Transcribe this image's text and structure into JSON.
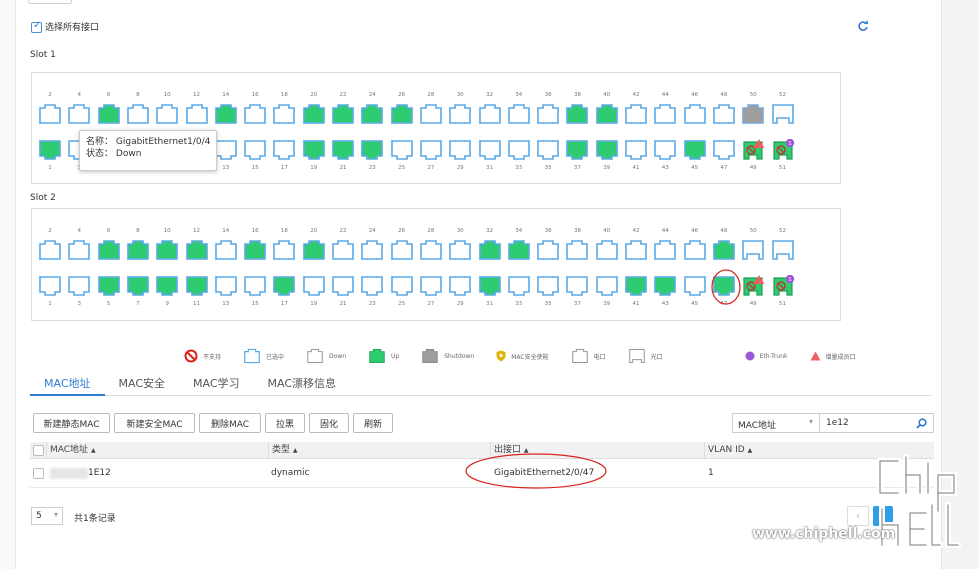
{
  "header": {
    "select_all_label": "选择所有接口"
  },
  "slots": [
    {
      "title": "Slot 1",
      "top_row": [
        {
          "num": "2",
          "state": "sel"
        },
        {
          "num": "4",
          "state": "sel"
        },
        {
          "num": "6",
          "state": "up"
        },
        {
          "num": "8",
          "state": "sel"
        },
        {
          "num": "10",
          "state": "sel"
        },
        {
          "num": "12",
          "state": "sel"
        },
        {
          "num": "14",
          "state": "up"
        },
        {
          "num": "16",
          "state": "sel"
        },
        {
          "num": "18",
          "state": "sel"
        },
        {
          "num": "20",
          "state": "up"
        },
        {
          "num": "22",
          "state": "up"
        },
        {
          "num": "24",
          "state": "up"
        },
        {
          "num": "26",
          "state": "up"
        },
        {
          "num": "28",
          "state": "sel"
        },
        {
          "num": "30",
          "state": "sel"
        },
        {
          "num": "32",
          "state": "sel"
        },
        {
          "num": "34",
          "state": "sel"
        },
        {
          "num": "36",
          "state": "sel"
        },
        {
          "num": "38",
          "state": "up"
        },
        {
          "num": "40",
          "state": "up"
        },
        {
          "num": "42",
          "state": "sel"
        },
        {
          "num": "44",
          "state": "sel"
        },
        {
          "num": "46",
          "state": "sel"
        },
        {
          "num": "48",
          "state": "sel"
        },
        {
          "num": "50",
          "state": "shutdown"
        },
        {
          "num": "52",
          "state": "optical"
        }
      ],
      "bottom_row": [
        {
          "num": "1",
          "state": "up"
        },
        {
          "num": "3",
          "state": "sel"
        },
        {
          "num": "5",
          "state": "sel"
        },
        {
          "num": "7",
          "state": "sel"
        },
        {
          "num": "9",
          "state": "sel"
        },
        {
          "num": "11",
          "state": "sel"
        },
        {
          "num": "13",
          "state": "sel"
        },
        {
          "num": "15",
          "state": "sel"
        },
        {
          "num": "17",
          "state": "sel"
        },
        {
          "num": "19",
          "state": "up"
        },
        {
          "num": "21",
          "state": "up"
        },
        {
          "num": "23",
          "state": "up"
        },
        {
          "num": "25",
          "state": "sel"
        },
        {
          "num": "27",
          "state": "sel"
        },
        {
          "num": "29",
          "state": "sel"
        },
        {
          "num": "31",
          "state": "sel"
        },
        {
          "num": "33",
          "state": "sel"
        },
        {
          "num": "35",
          "state": "sel"
        },
        {
          "num": "37",
          "state": "up"
        },
        {
          "num": "39",
          "state": "up"
        },
        {
          "num": "41",
          "state": "sel"
        },
        {
          "num": "43",
          "state": "sel"
        },
        {
          "num": "45",
          "state": "up"
        },
        {
          "num": "47",
          "state": "sel"
        },
        {
          "num": "49",
          "state": "special_member"
        },
        {
          "num": "51",
          "state": "special_trunk"
        }
      ]
    },
    {
      "title": "Slot 2",
      "top_row": [
        {
          "num": "2",
          "state": "sel"
        },
        {
          "num": "4",
          "state": "sel"
        },
        {
          "num": "6",
          "state": "up"
        },
        {
          "num": "8",
          "state": "up"
        },
        {
          "num": "10",
          "state": "up"
        },
        {
          "num": "12",
          "state": "up"
        },
        {
          "num": "14",
          "state": "sel"
        },
        {
          "num": "16",
          "state": "up"
        },
        {
          "num": "18",
          "state": "sel"
        },
        {
          "num": "20",
          "state": "up"
        },
        {
          "num": "22",
          "state": "sel"
        },
        {
          "num": "24",
          "state": "sel"
        },
        {
          "num": "26",
          "state": "sel"
        },
        {
          "num": "28",
          "state": "sel"
        },
        {
          "num": "30",
          "state": "sel"
        },
        {
          "num": "32",
          "state": "up"
        },
        {
          "num": "34",
          "state": "up"
        },
        {
          "num": "36",
          "state": "sel"
        },
        {
          "num": "38",
          "state": "sel"
        },
        {
          "num": "40",
          "state": "sel"
        },
        {
          "num": "42",
          "state": "sel"
        },
        {
          "num": "44",
          "state": "sel"
        },
        {
          "num": "46",
          "state": "sel"
        },
        {
          "num": "48",
          "state": "up"
        },
        {
          "num": "50",
          "state": "optical"
        },
        {
          "num": "52",
          "state": "optical"
        }
      ],
      "bottom_row": [
        {
          "num": "1",
          "state": "sel"
        },
        {
          "num": "3",
          "state": "sel"
        },
        {
          "num": "5",
          "state": "up"
        },
        {
          "num": "7",
          "state": "up"
        },
        {
          "num": "9",
          "state": "up"
        },
        {
          "num": "11",
          "state": "up"
        },
        {
          "num": "13",
          "state": "sel"
        },
        {
          "num": "15",
          "state": "sel"
        },
        {
          "num": "17",
          "state": "up"
        },
        {
          "num": "19",
          "state": "sel"
        },
        {
          "num": "21",
          "state": "sel"
        },
        {
          "num": "23",
          "state": "sel"
        },
        {
          "num": "25",
          "state": "sel"
        },
        {
          "num": "27",
          "state": "sel"
        },
        {
          "num": "29",
          "state": "sel"
        },
        {
          "num": "31",
          "state": "up"
        },
        {
          "num": "33",
          "state": "sel"
        },
        {
          "num": "35",
          "state": "sel"
        },
        {
          "num": "37",
          "state": "sel"
        },
        {
          "num": "39",
          "state": "sel"
        },
        {
          "num": "41",
          "state": "up"
        },
        {
          "num": "43",
          "state": "up"
        },
        {
          "num": "45",
          "state": "sel"
        },
        {
          "num": "47",
          "state": "up"
        },
        {
          "num": "49",
          "state": "special_member"
        },
        {
          "num": "51",
          "state": "special_trunk"
        }
      ]
    }
  ],
  "tooltip": {
    "name_label": "名称：",
    "name_value": "GigabitEthernet1/0/4",
    "status_label": "状态：",
    "status_value": "Down"
  },
  "legend": [
    {
      "icon": "not-supported",
      "label": "不支持"
    },
    {
      "icon": "selected-port",
      "label": "已选中"
    },
    {
      "icon": "down-port",
      "label": "Down"
    },
    {
      "icon": "up-port",
      "label": "Up"
    },
    {
      "icon": "shutdown-port",
      "label": "Shutdown"
    },
    {
      "icon": "mac-security-shield",
      "label": "MAC安全使能"
    },
    {
      "icon": "electrical-port",
      "label": "电口"
    },
    {
      "icon": "optical-port",
      "label": "光口"
    },
    {
      "icon": "eth-trunk-dot",
      "label": "Eth-Trunk"
    },
    {
      "icon": "member-triangle",
      "label": "增量成员口"
    }
  ],
  "tabs": [
    {
      "label": "MAC地址",
      "active": true
    },
    {
      "label": "MAC安全",
      "active": false
    },
    {
      "label": "MAC学习",
      "active": false
    },
    {
      "label": "MAC漂移信息",
      "active": false
    }
  ],
  "toolbar": {
    "buttons": [
      "新建静态MAC",
      "新建安全MAC",
      "删除MAC",
      "拉黑",
      "固化",
      "刷新"
    ],
    "filter_select": "MAC地址",
    "search_value": "1e12"
  },
  "table": {
    "columns": [
      "MAC地址",
      "类型",
      "出接口",
      "VLAN ID"
    ],
    "rows": [
      {
        "mac": "1E12",
        "type": "dynamic",
        "interface": "GigabitEthernet2/0/47",
        "vlan": "1"
      }
    ]
  },
  "footer": {
    "page_size": "5",
    "total": "共1条记录",
    "current_page": "1"
  },
  "watermark": {
    "site": "www.chiphell.com"
  },
  "colors": {
    "accent": "#2f7cd6",
    "up": "#2ecc71",
    "selected_border": "#5aa9e6",
    "shutdown": "#9e9e9e",
    "annotation": "#d8261c"
  }
}
